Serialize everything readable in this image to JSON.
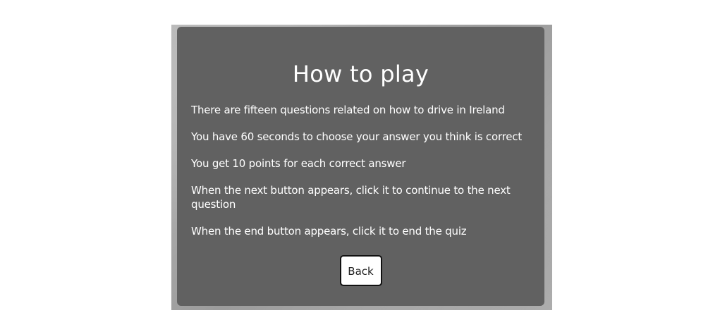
{
  "card": {
    "title": "How to play",
    "rules": [
      "There are fifteen questions related on how to drive in Ireland",
      "You have 60 seconds to choose your answer you think is correct",
      "You get 10 points for each correct answer",
      "When the next button appears, click it to continue to the next question",
      "When the end button appears, click it to end the quiz"
    ],
    "back_label": "Back"
  },
  "colors": {
    "card_background": "#616161",
    "text": "#ffffff",
    "button_background": "#ffffff",
    "button_border": "#111111"
  }
}
